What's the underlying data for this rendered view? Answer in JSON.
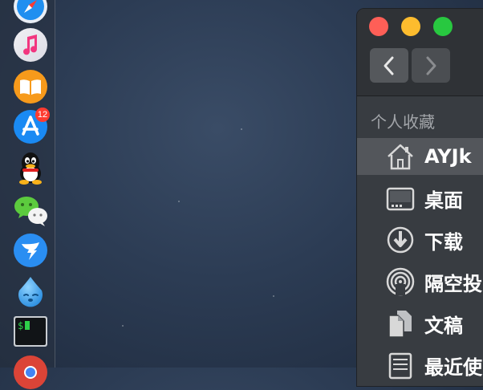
{
  "dock": {
    "items": [
      {
        "name": "Safari",
        "icon": "safari-icon"
      },
      {
        "name": "Music",
        "icon": "music-icon"
      },
      {
        "name": "Books",
        "icon": "books-icon"
      },
      {
        "name": "App Store",
        "icon": "app-store-icon",
        "badge": "12"
      },
      {
        "name": "QQ",
        "icon": "qq-icon"
      },
      {
        "name": "WeChat",
        "icon": "wechat-icon"
      },
      {
        "name": "DingTalk",
        "icon": "dingtalk-icon"
      },
      {
        "name": "Drop",
        "icon": "water-drop-icon"
      },
      {
        "name": "Terminal",
        "icon": "terminal-icon",
        "glyph": "$"
      },
      {
        "name": "Chrome",
        "icon": "chrome-icon"
      }
    ]
  },
  "finder": {
    "traffic_lights": {
      "close": "#fe5f57",
      "minimize": "#fdbc2e",
      "zoom": "#28c840"
    },
    "sidebar": {
      "heading": "个人收藏",
      "items": [
        {
          "label": "AYJk",
          "icon": "home-icon",
          "selected": true
        },
        {
          "label": "桌面",
          "icon": "desktop-icon"
        },
        {
          "label": "下载",
          "icon": "downloads-icon"
        },
        {
          "label": "隔空投",
          "icon": "airdrop-icon"
        },
        {
          "label": "文稿",
          "icon": "documents-icon"
        },
        {
          "label": "最近使",
          "icon": "recents-icon"
        }
      ]
    }
  }
}
